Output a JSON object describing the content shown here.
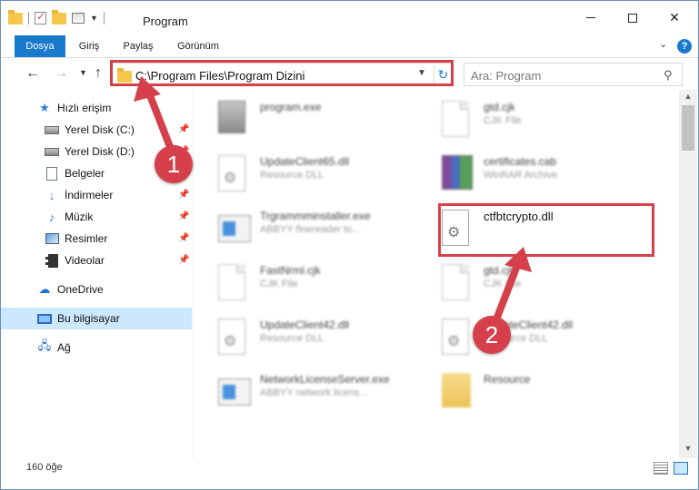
{
  "window": {
    "title": "Program",
    "minimize_label": "",
    "close_label": "✕"
  },
  "ribbon": {
    "tabs": [
      "Dosya",
      "Giriş",
      "Paylaş",
      "Görünüm"
    ],
    "help_label": "?"
  },
  "address": {
    "path": "C:\\Program Files\\Program Dizini",
    "search_placeholder": "Ara: Program"
  },
  "sidebar": {
    "items": [
      {
        "label": "Hızlı erişim",
        "icon": "star-icon"
      },
      {
        "label": "Yerel Disk (C:)",
        "icon": "disk-icon",
        "pinned": true
      },
      {
        "label": "Yerel Disk (D:)",
        "icon": "disk-icon",
        "pinned": true
      },
      {
        "label": "Belgeler",
        "icon": "document-icon",
        "pinned": true
      },
      {
        "label": "İndirmeler",
        "icon": "download-icon",
        "pinned": true
      },
      {
        "label": "Müzik",
        "icon": "music-icon",
        "pinned": true
      },
      {
        "label": "Resimler",
        "icon": "pictures-icon",
        "pinned": true
      },
      {
        "label": "Videolar",
        "icon": "videos-icon",
        "pinned": true
      },
      {
        "label": "OneDrive",
        "icon": "cloud-icon"
      },
      {
        "label": "Bu bilgisayar",
        "icon": "computer-icon",
        "selected": true
      },
      {
        "label": "Ağ",
        "icon": "network-icon"
      }
    ]
  },
  "files": [
    {
      "name": "program.exe",
      "type": "",
      "icon": "program-icon",
      "blurred": true
    },
    {
      "name": "gtd.cjk",
      "type": "CJK File",
      "icon": "generic-file-icon",
      "blurred": true
    },
    {
      "name": "UpdateClient65.dll",
      "type": "Resource DLL",
      "icon": "dll-icon",
      "blurred": true
    },
    {
      "name": "certificates.cab",
      "type": "WinRAR Archive",
      "icon": "archive-icon",
      "blurred": true
    },
    {
      "name": "Trgrammminstaller.exe",
      "type": "ABBYY finereader to...",
      "icon": "exe-icon",
      "blurred": true
    },
    {
      "name": "ctfbtcrypto.dll",
      "type": "",
      "icon": "dll-icon",
      "blurred": false
    },
    {
      "name": "FastNrml.cjk",
      "type": "CJK File",
      "icon": "generic-file-icon",
      "blurred": true
    },
    {
      "name": "gtd.cjk",
      "type": "CJK File",
      "icon": "generic-file-icon",
      "blurred": true
    },
    {
      "name": "UpdateClient42.dll",
      "type": "Resource DLL",
      "icon": "dll-icon",
      "blurred": true
    },
    {
      "name": "UpdateClient42.dll",
      "type": "Resource DLL",
      "icon": "dll-icon",
      "blurred": true
    },
    {
      "name": "NetworkLicenseServer.exe",
      "type": "ABBYY network licens...",
      "icon": "exe-icon",
      "blurred": true
    },
    {
      "name": "Resource",
      "type": "",
      "icon": "folder-icon",
      "blurred": true
    }
  ],
  "status": {
    "item_count": "160 öğe"
  },
  "annotations": {
    "badge_1": "1",
    "badge_2": "2",
    "highlight_color": "#d5404a"
  },
  "colors": {
    "accent": "#1979ca",
    "selection": "#cce8ff"
  }
}
